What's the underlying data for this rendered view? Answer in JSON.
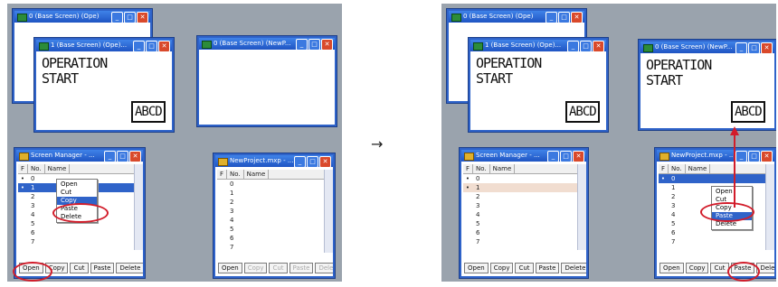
{
  "arrow": "→",
  "left": {
    "base0_title": "0 (Base Screen) (Ope)",
    "base1_title": "1 (Base Screen) (Ope)...",
    "base1_text1": "OPERATION",
    "base1_text2": "START",
    "base1_part": "ABCD",
    "new0_title": "0 (Base Screen) (NewP...",
    "sm_title": "Screen Manager - ...",
    "sm_cols": [
      "F",
      "No.",
      "Name"
    ],
    "sm_rows": [
      {
        "f": "•",
        "n": "0"
      },
      {
        "f": "•",
        "n": "1"
      },
      {
        "f": "",
        "n": "2"
      },
      {
        "f": "",
        "n": "3"
      },
      {
        "f": "",
        "n": "4"
      },
      {
        "f": "",
        "n": "5"
      },
      {
        "f": "",
        "n": "6"
      },
      {
        "f": "",
        "n": "7"
      }
    ],
    "menu": [
      "Open",
      "Cut",
      "Copy",
      "Paste",
      "Delete"
    ],
    "buttons": [
      "Open",
      "Copy",
      "Cut",
      "Paste",
      "Delete"
    ],
    "np_title": "NewProject.mxp - ...",
    "np_cols": [
      "F",
      "No.",
      "Name"
    ],
    "np_rows": [
      "0",
      "1",
      "2",
      "3",
      "4",
      "5",
      "6",
      "7"
    ],
    "np_buttons": [
      "Open",
      "Copy",
      "Cut",
      "Paste",
      "Delete"
    ]
  },
  "right": {
    "base0_title": "0 (Base Screen) (Ope)",
    "base1_title": "1 (Base Screen) (Ope)...",
    "base1_text1": "OPERATION",
    "base1_text2": "START",
    "base1_part": "ABCD",
    "new0_title": "0 (Base Screen) (NewP...",
    "new0_text1": "OPERATION",
    "new0_text2": "START",
    "new0_part": "ABCD",
    "sm_title": "Screen Manager - ...",
    "sm_cols": [
      "F",
      "No.",
      "Name"
    ],
    "sm_rows": [
      {
        "f": "•",
        "n": "0"
      },
      {
        "f": "•",
        "n": "1"
      },
      {
        "f": "",
        "n": "2"
      },
      {
        "f": "",
        "n": "3"
      },
      {
        "f": "",
        "n": "4"
      },
      {
        "f": "",
        "n": "5"
      },
      {
        "f": "",
        "n": "6"
      },
      {
        "f": "",
        "n": "7"
      }
    ],
    "sm_buttons": [
      "Open",
      "Copy",
      "Cut",
      "Paste",
      "Delete"
    ],
    "np_title": "NewProject.mxp - ...",
    "np_cols": [
      "F",
      "No.",
      "Name"
    ],
    "np_rows": [
      {
        "f": "•",
        "n": "0"
      },
      {
        "f": "",
        "n": "1"
      },
      {
        "f": "",
        "n": "2"
      },
      {
        "f": "",
        "n": "3"
      },
      {
        "f": "",
        "n": "4"
      },
      {
        "f": "",
        "n": "5"
      },
      {
        "f": "",
        "n": "6"
      },
      {
        "f": "",
        "n": "7"
      }
    ],
    "menu": [
      "Open",
      "Cut",
      "Copy",
      "Paste",
      "Delete"
    ],
    "np_buttons": [
      "Open",
      "Copy",
      "Cut",
      "Paste",
      "Delete"
    ]
  },
  "colors": {
    "highlight_ring": "#d21c2a",
    "title_bar": "#1f54c3",
    "selection": "#2f63c9"
  }
}
